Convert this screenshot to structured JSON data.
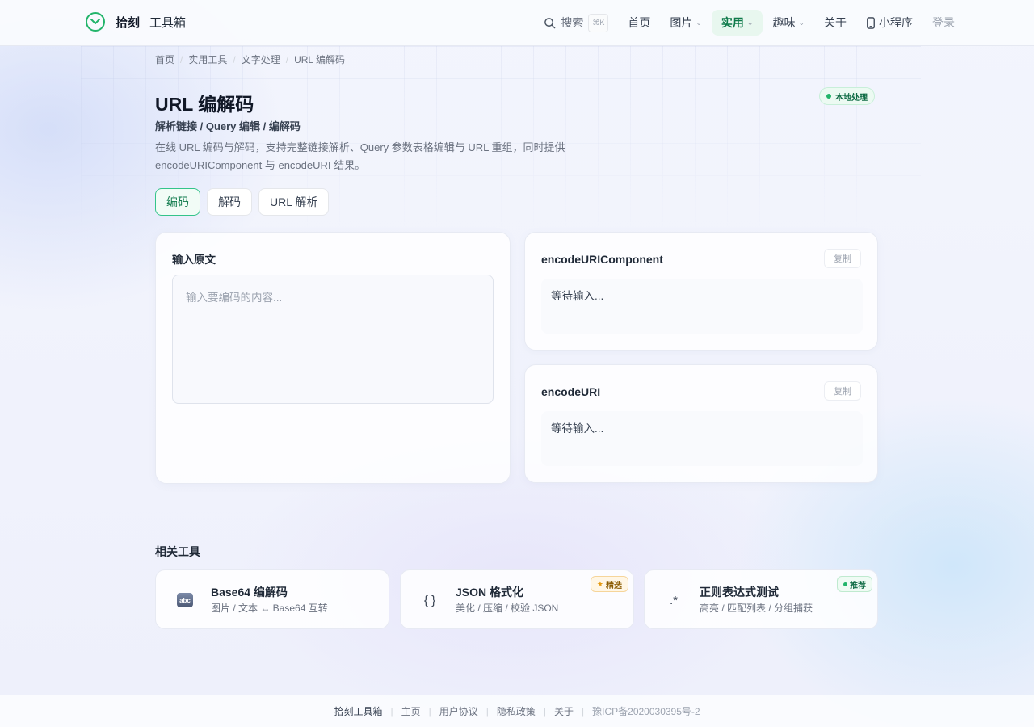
{
  "header": {
    "brand_name": "拾刻",
    "brand_sub": "工具箱",
    "search_label": "搜索",
    "search_shortcut": "⌘K",
    "nav": [
      {
        "label": "首页"
      },
      {
        "label": "图片"
      },
      {
        "label": "实用"
      },
      {
        "label": "趣味"
      },
      {
        "label": "关于"
      },
      {
        "label": "小程序"
      }
    ],
    "login_label": "登录",
    "accent_color": "#16a34a"
  },
  "breadcrumb": [
    "首页",
    "实用工具",
    "文字处理",
    "URL 编解码"
  ],
  "page": {
    "title": "URL 编解码",
    "subtitle": "解析链接 / Query 编辑 / 编解码",
    "description": "在线 URL 编码与解码，支持完整链接解析、Query 参数表格编辑与 URL 重组，同时提供 encodeURIComponent 与 encodeURI 结果。",
    "badge": "本地处理"
  },
  "tabs": [
    {
      "label": "编码",
      "active": true
    },
    {
      "label": "解码",
      "active": false
    },
    {
      "label": "URL 解析",
      "active": false
    }
  ],
  "input_card": {
    "label": "输入原文",
    "value": "",
    "placeholder": "输入要编码的内容..."
  },
  "outputs": [
    {
      "title": "encodeURIComponent",
      "copy_label": "复制",
      "result": "等待输入..."
    },
    {
      "title": "encodeURI",
      "copy_label": "复制",
      "result": "等待输入..."
    }
  ],
  "related": {
    "title": "相关工具",
    "items": [
      {
        "icon": "abc-icon",
        "icon_text": "abc",
        "name": "Base64 编解码",
        "desc": "图片 / 文本 ↔ Base64 互转",
        "badge": ""
      },
      {
        "icon": "braces-icon",
        "icon_text": "{ }",
        "name": "JSON 格式化",
        "desc": "美化 / 压缩 / 校验 JSON",
        "badge": "精选"
      },
      {
        "icon": "regex-icon",
        "icon_text": ".*",
        "name": "正则表达式测试",
        "desc": "高亮 / 匹配列表 / 分组捕获",
        "badge": "推荐"
      }
    ]
  },
  "footer": {
    "brand": "拾刻工具箱",
    "links": [
      "主页",
      "用户协议",
      "隐私政策",
      "关于"
    ],
    "icp": "豫ICP备2020030395号-2"
  }
}
